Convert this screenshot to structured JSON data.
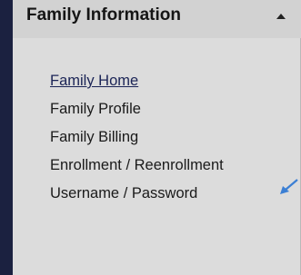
{
  "menu": {
    "title": "Family Information",
    "toggle_icon": "caret-up-icon",
    "items": [
      {
        "label": "Family Home",
        "active": true
      },
      {
        "label": "Family Profile",
        "active": false
      },
      {
        "label": "Family Billing",
        "active": false
      },
      {
        "label": "Enrollment / Reenrollment",
        "active": false
      },
      {
        "label": "Username / Password",
        "active": false
      }
    ]
  },
  "annotation": {
    "icon": "pointer-arrow-icon",
    "color": "#3b7fd4"
  },
  "colors": {
    "sidebar_accent": "#1b2140",
    "panel_background": "#dcdcdc",
    "header_background": "#d2d2d2"
  }
}
